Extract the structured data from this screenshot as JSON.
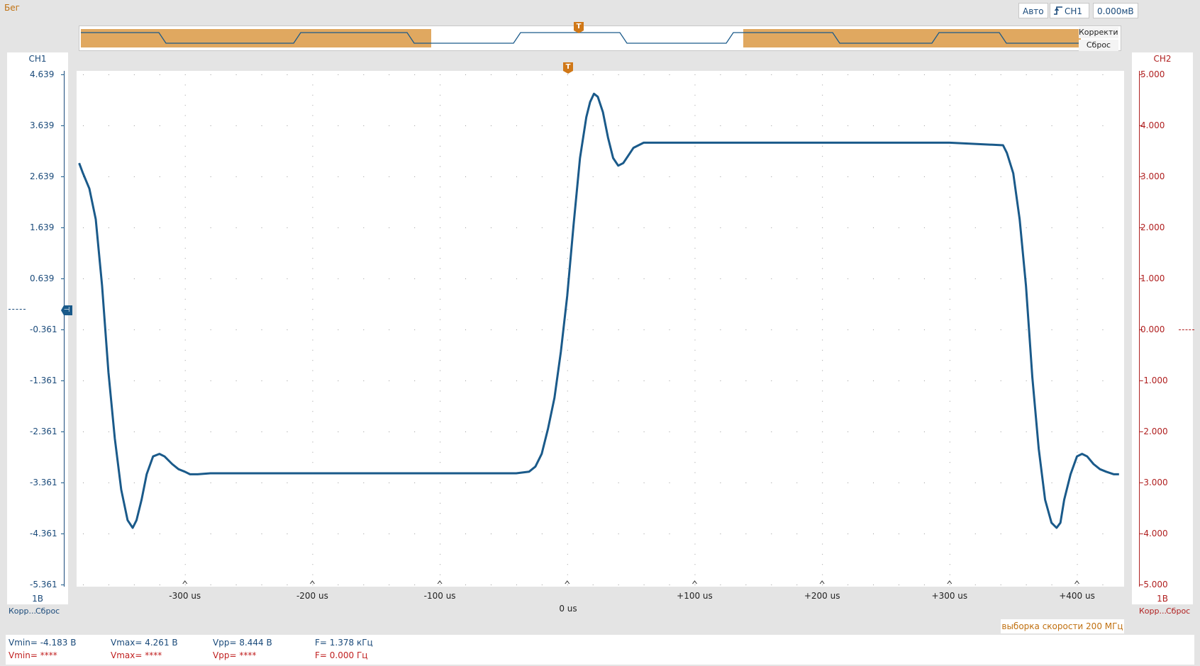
{
  "status": {
    "run": "Бег"
  },
  "top_controls": {
    "mode": "Авто",
    "trigger_channel": "CH1",
    "trigger_level": "0.000мВ"
  },
  "overview": {
    "corr_label": "Корректи...",
    "reset_label": "Сброс"
  },
  "ch1": {
    "title": "CH1",
    "ticks": [
      "4.639",
      "3.639",
      "2.639",
      "1.639",
      "0.639",
      "-0.361",
      "-1.361",
      "-2.361",
      "-3.361",
      "-4.361",
      "-5.361"
    ],
    "scale": "1В",
    "corr_label": "Корр...",
    "reset_label": "Сброс",
    "color": "#1a5a8a"
  },
  "ch2": {
    "title": "CH2",
    "ticks": [
      "5.000",
      "4.000",
      "3.000",
      "2.000",
      "1.000",
      "0.000",
      "-1.000",
      "-2.000",
      "-3.000",
      "-4.000",
      "-5.000"
    ],
    "scale": "1В",
    "corr_label": "Корр...",
    "reset_label": "Сброс",
    "color": "#b02020"
  },
  "x_axis": {
    "ticks": [
      "-300 us",
      "-200 us",
      "-100 us",
      "",
      "+100 us",
      "+200 us",
      "+300 us",
      "+400 us"
    ],
    "center_label": "0 us"
  },
  "trigger_marker": "T",
  "sample_rate": "выборка скорости 200 МГц",
  "measurements": {
    "ch1": {
      "vmin": "Vmin= -4.183 В",
      "vmax": "Vmax= 4.261 В",
      "vpp": "Vpp= 8.444 В",
      "freq": "F= 1.378 кГц"
    },
    "ch2": {
      "vmin": "Vmin= ****",
      "vmax": "Vmax= ****",
      "vpp": "Vpp= ****",
      "freq": "F= 0.000 Гц"
    }
  },
  "chart_data": {
    "type": "line",
    "x_unit": "us",
    "xlim": [
      -385,
      437
    ],
    "ylim_ch1": [
      -5.361,
      4.639
    ],
    "series": [
      {
        "name": "CH1",
        "x": [
          -383,
          -380,
          -375,
          -370,
          -365,
          -360,
          -355,
          -350,
          -345,
          -341,
          -338,
          -334,
          -330,
          -325,
          -320,
          -316,
          -310,
          -305,
          -300,
          -296,
          -290,
          -280,
          -200,
          -100,
          -40,
          -30,
          -25,
          -20,
          -15,
          -10,
          -5,
          0,
          5,
          10,
          15,
          18,
          21,
          24,
          28,
          32,
          36,
          40,
          44,
          48,
          52,
          56,
          60,
          65,
          70,
          80,
          100,
          200,
          300,
          342,
          345,
          350,
          355,
          360,
          365,
          370,
          375,
          380,
          384,
          387,
          390,
          395,
          400,
          404,
          408,
          413,
          418,
          423,
          429,
          433
        ],
        "y": [
          2.9,
          2.7,
          2.4,
          1.8,
          0.5,
          -1.2,
          -2.5,
          -3.5,
          -4.1,
          -4.25,
          -4.1,
          -3.7,
          -3.2,
          -2.85,
          -2.8,
          -2.85,
          -3.0,
          -3.1,
          -3.15,
          -3.2,
          -3.2,
          -3.18,
          -3.18,
          -3.18,
          -3.18,
          -3.15,
          -3.05,
          -2.8,
          -2.3,
          -1.7,
          -0.8,
          0.3,
          1.7,
          3.0,
          3.8,
          4.1,
          4.26,
          4.2,
          3.9,
          3.4,
          3.0,
          2.85,
          2.9,
          3.05,
          3.2,
          3.25,
          3.3,
          3.3,
          3.3,
          3.3,
          3.3,
          3.3,
          3.3,
          3.25,
          3.1,
          2.7,
          1.8,
          0.5,
          -1.3,
          -2.7,
          -3.7,
          -4.15,
          -4.25,
          -4.15,
          -3.7,
          -3.2,
          -2.85,
          -2.8,
          -2.85,
          -3.0,
          -3.1,
          -3.15,
          -3.2,
          -3.2
        ]
      }
    ]
  }
}
